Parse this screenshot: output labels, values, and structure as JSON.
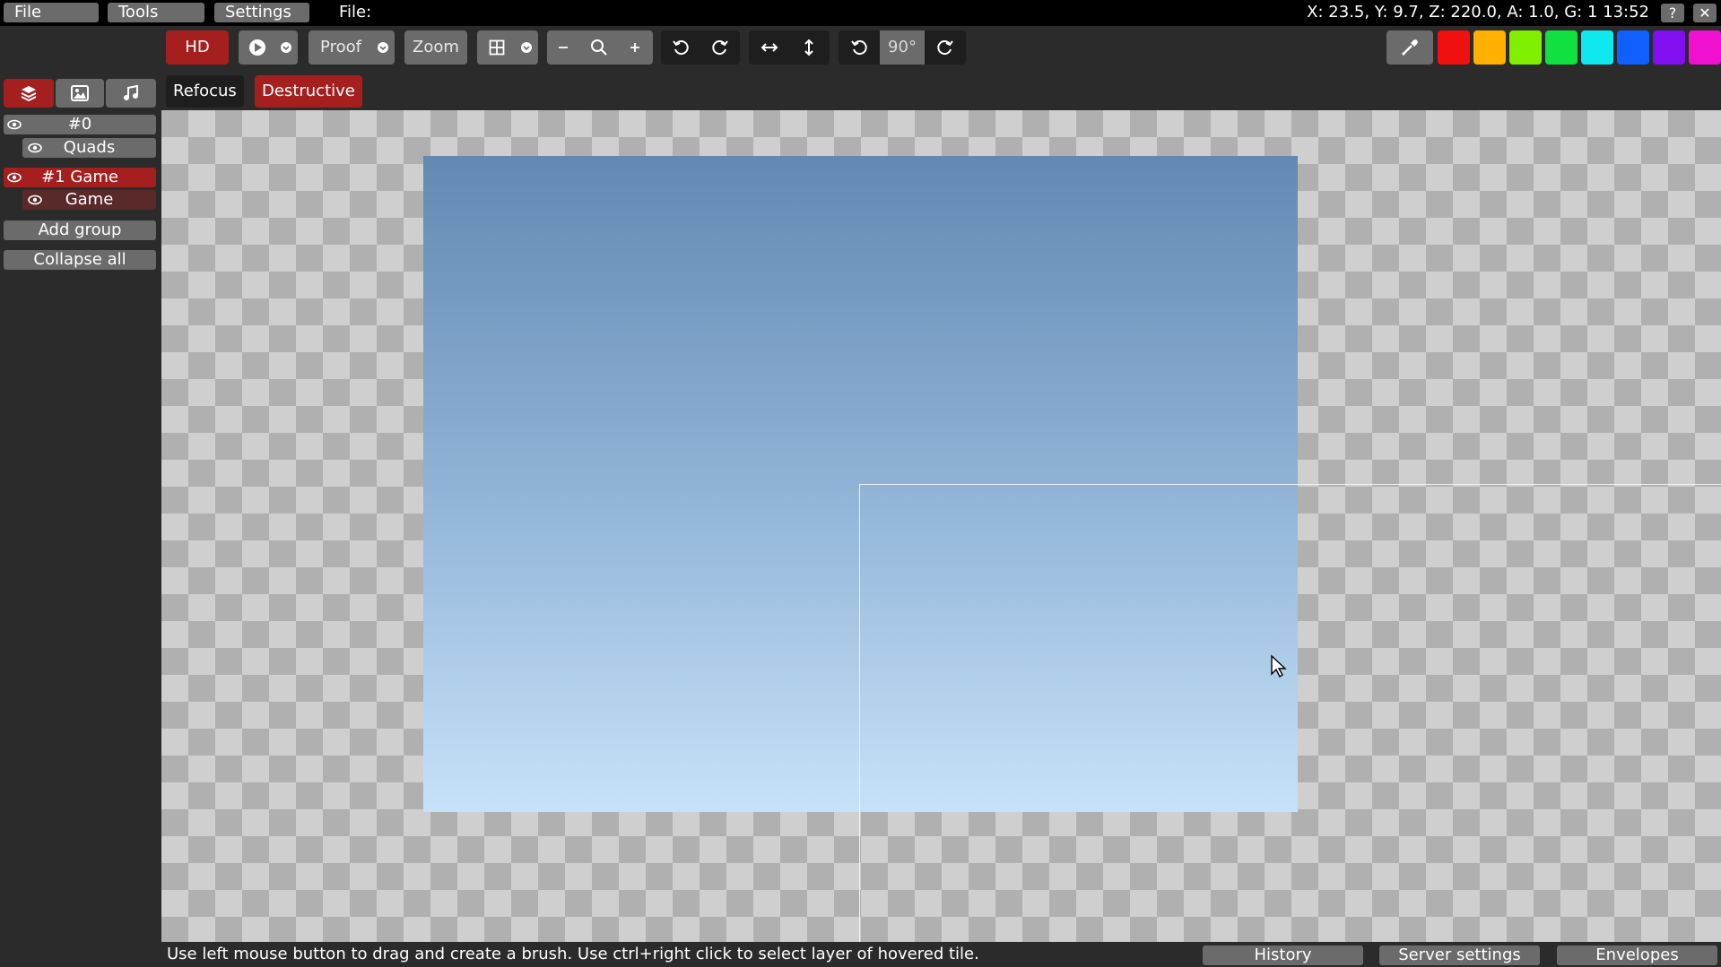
{
  "menu": {
    "file": "File",
    "tools": "Tools",
    "settings": "Settings",
    "file_label": "File:"
  },
  "status": {
    "readout": "X: 23.5, Y: 9.7, Z: 220.0, A: 1.0, G: 1  13:52",
    "help": "?",
    "close": "✕"
  },
  "toolbar": {
    "hd": "HD",
    "proof": "Proof",
    "zoom": "Zoom",
    "rotation": "90°"
  },
  "palette": {
    "colors": [
      "#f01010",
      "#ffb000",
      "#80f000",
      "#10e040",
      "#10e8f0",
      "#1060ff",
      "#8010f0",
      "#f010d0"
    ]
  },
  "tabs": {
    "refocus": "Refocus",
    "destructive": "Destructive"
  },
  "layers": {
    "group0": "#0",
    "quads": "Quads",
    "group1": "#1 Game",
    "game": "Game",
    "add_group": "Add group",
    "collapse_all": "Collapse all"
  },
  "bottom": {
    "hint": "Use left mouse button to drag and create a brush. Use ctrl+right click to select layer of hovered tile.",
    "history": "History",
    "server_settings": "Server settings",
    "envelopes": "Envelopes"
  }
}
